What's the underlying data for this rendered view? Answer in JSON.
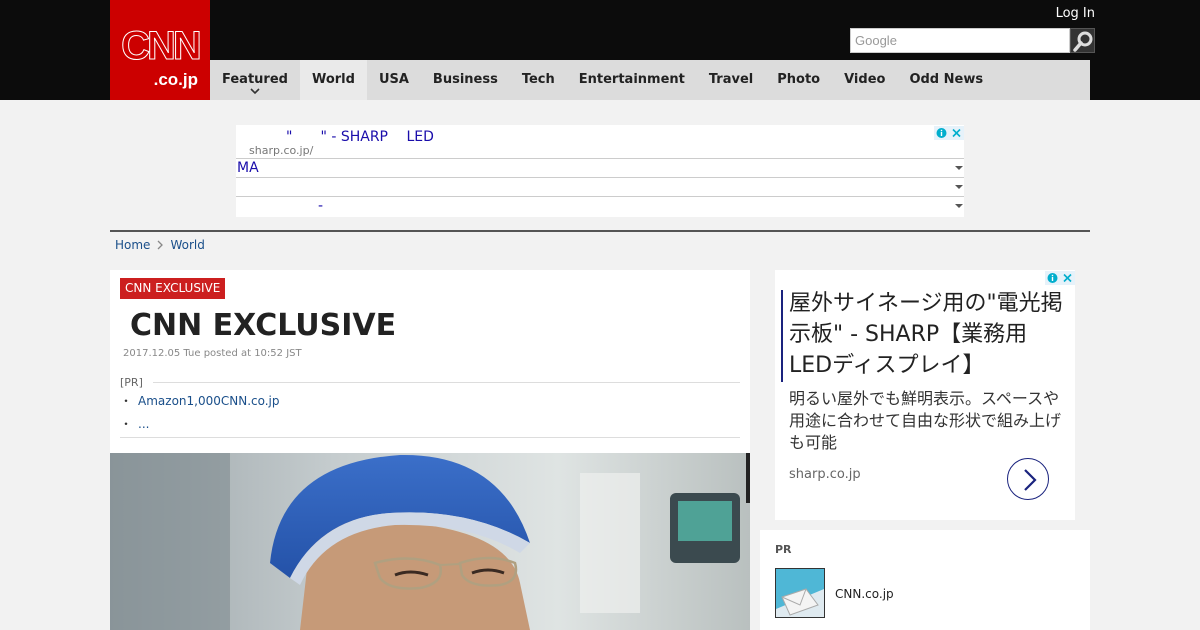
{
  "header": {
    "logo_main": "CNN",
    "logo_sub": ".co.jp",
    "login": "Log In",
    "search_placeholder": "Google"
  },
  "nav": {
    "items": [
      {
        "label": "Featured"
      },
      {
        "label": "World"
      },
      {
        "label": "USA"
      },
      {
        "label": "Business"
      },
      {
        "label": "Tech"
      },
      {
        "label": "Entertainment"
      },
      {
        "label": "Travel"
      },
      {
        "label": "Photo"
      },
      {
        "label": "Video"
      },
      {
        "label": "Odd News"
      }
    ]
  },
  "ad_top": {
    "title": "\"　　\" - SHARP　 LED",
    "url": "sharp.co.jp/",
    "rows": [
      "MA",
      "",
      "-"
    ]
  },
  "breadcrumb": {
    "home": "Home",
    "current": "World"
  },
  "article": {
    "badge": "CNN EXCLUSIVE",
    "headline": "CNN EXCLUSIVE",
    "dateline": "2017.12.05 Tue posted at 10:52 JST",
    "pr_label": "[PR]",
    "pr_links": [
      "Amazon1,000CNN.co.jp",
      "..."
    ],
    "bullet": "・"
  },
  "ad_right": {
    "title": "屋外サイネージ用の\"電光掲示板\" - SHARP【業務用LEDディスプレイ】",
    "description": "明るい屋外でも鮮明表示。スペースや用途に合わせて自由な形状で組み上げも可能",
    "url": "sharp.co.jp"
  },
  "pr_right": {
    "label": "PR",
    "text": "CNN.co.jp"
  },
  "colors": {
    "brand_red": "#cc0000",
    "header_black": "#0c0c0c",
    "nav_gray": "#dcdcdc",
    "link_blue": "#1a4f8a",
    "ad_link": "#1a0dab",
    "badge_red": "#cc1f1f"
  }
}
